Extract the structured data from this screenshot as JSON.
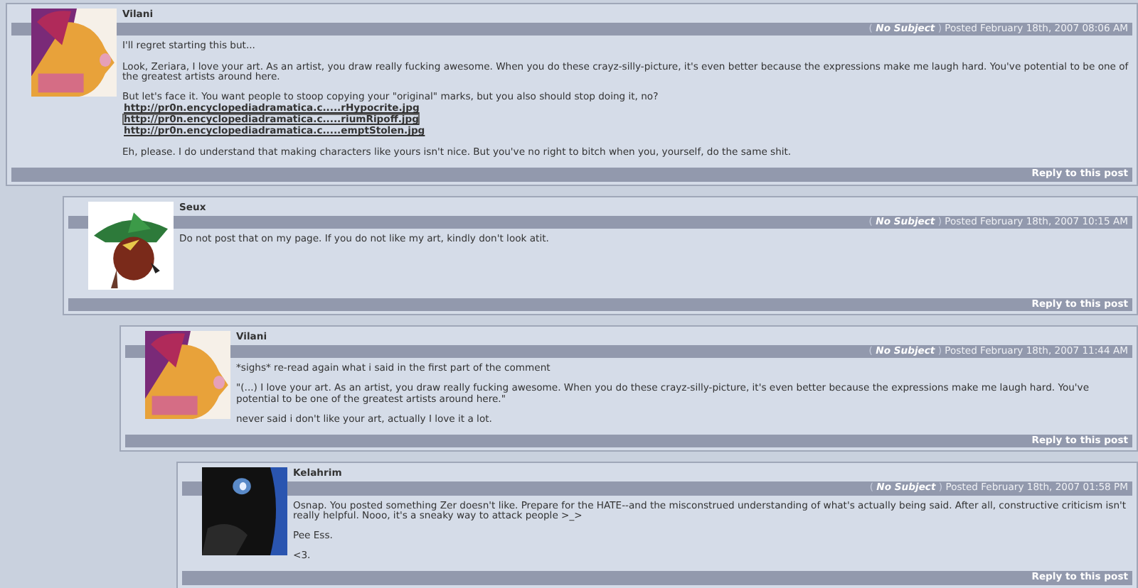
{
  "comments": [
    {
      "author": "Vilani",
      "header": {
        "open": "(",
        "subject": "No Subject",
        "close": ")",
        "posted": "Posted February 18th, 2007 08:06 AM"
      },
      "body": [
        {
          "kind": "text",
          "text": "I'll regret starting this but..."
        },
        {
          "kind": "text",
          "text": "Look, Zeriara, I love your art. As an artist, you draw really fucking awesome. When you do these crayz-silly-picture, it's even better because the expressions make me laugh hard. You've potential to be one of the greatest artists around here."
        },
        {
          "kind": "links",
          "intro": "But let's face it. You want people to stoop copying your \"original\" marks, but you also should stop doing it, no?",
          "links": [
            {
              "text": "http://pr0n.encyclopediadramatica.c.....rHypocrite.jpg",
              "focused": false
            },
            {
              "text": "http://pr0n.encyclopediadramatica.c.....riumRipoff.jpg",
              "focused": true
            },
            {
              "text": "http://pr0n.encyclopediadramatica.c.....emptStolen.jpg",
              "focused": false
            }
          ]
        },
        {
          "kind": "text",
          "text": "Eh, please. I do understand that making characters like yours isn't nice. But you've no right to bitch when you, yourself, do the same shit."
        }
      ],
      "reply": "Reply to this post",
      "children": [
        {
          "author": "Seux",
          "header": {
            "open": "(",
            "subject": "No Subject",
            "close": ")",
            "posted": "Posted February 18th, 2007 10:15 AM"
          },
          "body": [
            {
              "kind": "text",
              "text": "Do not post that on my page. If you do not like my art, kindly don't look atit."
            }
          ],
          "reply": "Reply to this post",
          "children": [
            {
              "author": "Vilani",
              "header": {
                "open": "(",
                "subject": "No Subject",
                "close": ")",
                "posted": "Posted February 18th, 2007 11:44 AM"
              },
              "body": [
                {
                  "kind": "text",
                  "text": "*sighs* re-read again what i said in the first part of the comment"
                },
                {
                  "kind": "text",
                  "text": "\"(...) I love your art. As an artist, you draw really fucking awesome. When you do these crayz-silly-picture, it's even better because the expressions make me laugh hard. You've potential to be one of the greatest artists around here.\""
                },
                {
                  "kind": "text",
                  "text": "never said i don't like your art, actually I love it a lot."
                }
              ],
              "reply": "Reply to this post",
              "children": [
                {
                  "author": "Kelahrim",
                  "header": {
                    "open": "(",
                    "subject": "No Subject",
                    "close": ")",
                    "posted": "Posted February 18th, 2007 01:58 PM"
                  },
                  "body": [
                    {
                      "kind": "text",
                      "text": "Osnap. You posted something Zer doesn't like. Prepare for the HATE--and the misconstrued understanding of what's actually being said. After all, constructive criticism isn't really helpful. Nooo, it's a sneaky way to attack people >_>"
                    },
                    {
                      "kind": "text",
                      "text": "Pee Ess."
                    },
                    {
                      "kind": "text",
                      "text": "<3."
                    }
                  ],
                  "reply": "Reply to this post"
                }
              ]
            }
          ]
        }
      ]
    }
  ]
}
